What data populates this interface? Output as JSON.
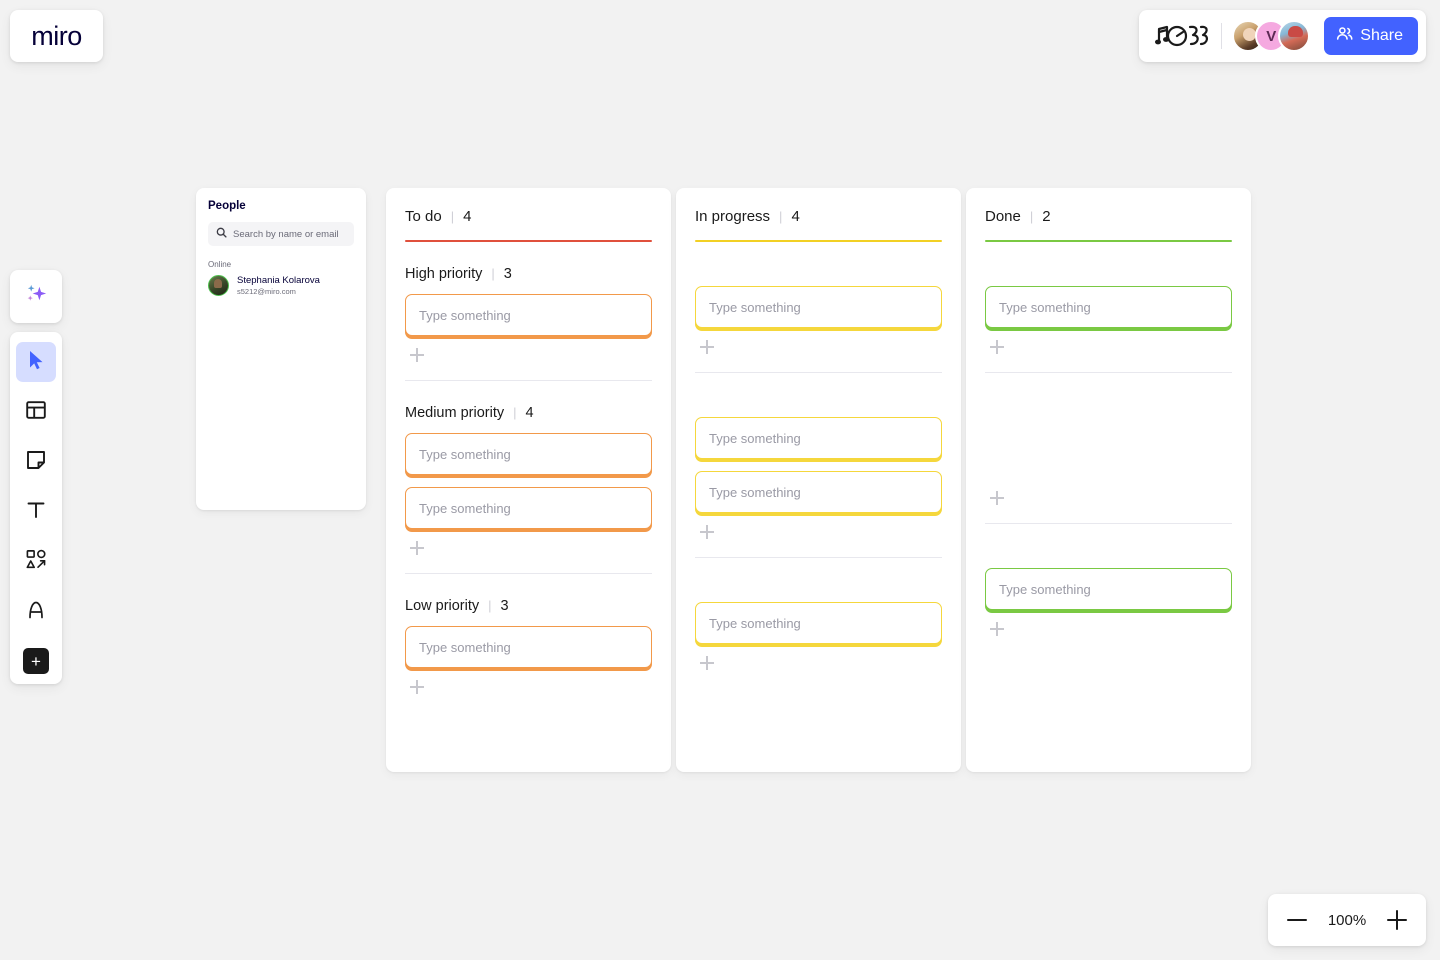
{
  "app": {
    "logo_text": "miro"
  },
  "topbar": {
    "doodle_icon": "music-doodle-icon",
    "share_label": "Share",
    "share_color": "#4262ff",
    "avatars": [
      {
        "name": "avatar-photo-1",
        "initial": ""
      },
      {
        "name": "avatar-initial-v",
        "initial": "V"
      },
      {
        "name": "avatar-photo-2",
        "initial": ""
      }
    ]
  },
  "toolbar": {
    "ai_label": "AI",
    "items": [
      {
        "name": "select-tool",
        "label": "Select",
        "active": true
      },
      {
        "name": "templates-tool",
        "label": "Templates",
        "active": false
      },
      {
        "name": "sticky-note-tool",
        "label": "Sticky note",
        "active": false
      },
      {
        "name": "text-tool",
        "label": "Text",
        "active": false
      },
      {
        "name": "shapes-tool",
        "label": "Shapes and connectors",
        "active": false
      },
      {
        "name": "pen-tool",
        "label": "Pen",
        "active": false
      }
    ],
    "more_label": "+"
  },
  "people": {
    "title": "People",
    "search_placeholder": "Search by name or email",
    "search_value": "",
    "online_label": "Online",
    "members": [
      {
        "name": "Stephania Kolarova",
        "email": "s5212@miro.com"
      }
    ]
  },
  "board": {
    "card_placeholder": "Type something",
    "columns": [
      {
        "title": "To do",
        "count": "4",
        "accent": "#e0503c",
        "card_border": "#f2994a",
        "sections": [
          {
            "title": "High priority",
            "count": "3",
            "cards": 1,
            "has_add": true,
            "has_sep": true
          },
          {
            "title": "Medium priority",
            "count": "4",
            "cards": 2,
            "has_add": true,
            "has_sep": true
          },
          {
            "title": "Low priority",
            "count": "3",
            "cards": 1,
            "has_add": true,
            "has_sep": false
          }
        ]
      },
      {
        "title": "In progress",
        "count": "4",
        "accent": "#f2d024",
        "card_border": "#f5d73c",
        "sections": [
          {
            "title": "",
            "count": "",
            "cards": 1,
            "has_add": true,
            "has_sep": true
          },
          {
            "title": "",
            "count": "",
            "cards": 2,
            "has_add": true,
            "has_sep": true
          },
          {
            "title": "",
            "count": "",
            "cards": 1,
            "has_add": true,
            "has_sep": false
          }
        ]
      },
      {
        "title": "Done",
        "count": "2",
        "accent": "#7ac943",
        "card_border": "#7ac943",
        "sections": [
          {
            "title": "",
            "count": "",
            "cards": 1,
            "has_add": true,
            "has_sep": true
          },
          {
            "title": "",
            "count": "",
            "cards": 0,
            "has_add": true,
            "has_sep": true
          },
          {
            "title": "",
            "count": "",
            "cards": 1,
            "has_add": true,
            "has_sep": false
          }
        ]
      }
    ]
  },
  "zoom": {
    "value": "100%",
    "minus_label": "Zoom out",
    "plus_label": "Zoom in"
  }
}
